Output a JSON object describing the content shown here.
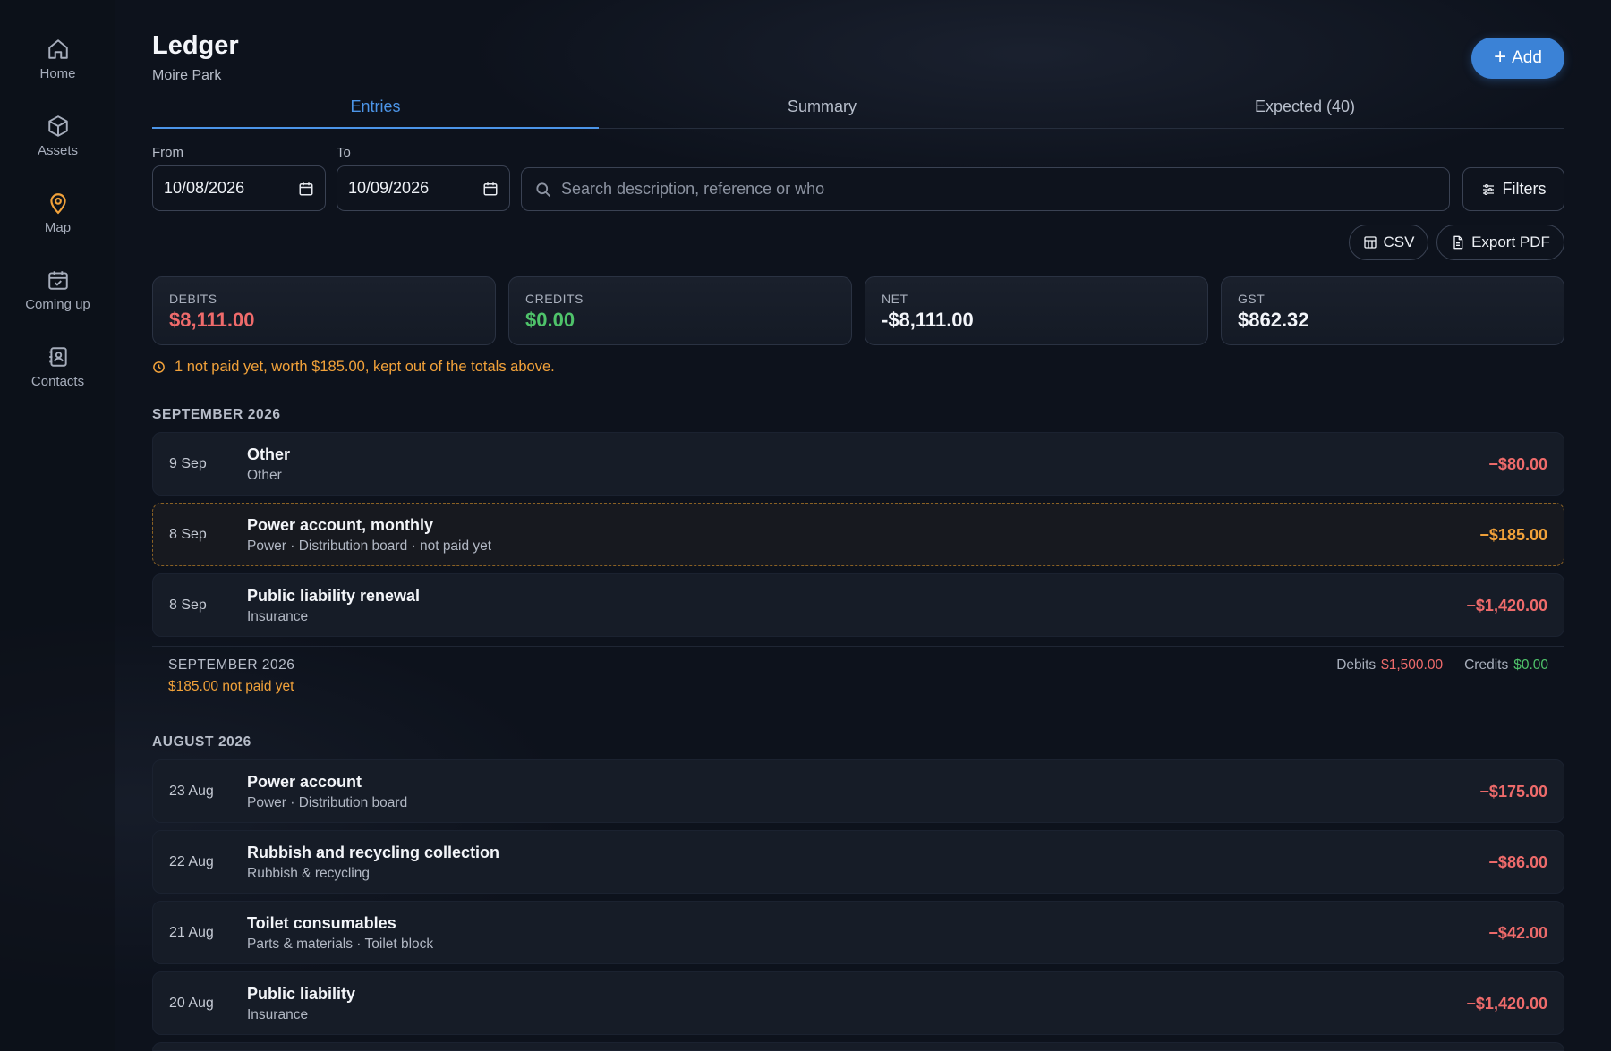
{
  "sidebar": {
    "items": [
      {
        "label": "Home",
        "icon": "home-icon",
        "active": false
      },
      {
        "label": "Assets",
        "icon": "cube-icon",
        "active": false
      },
      {
        "label": "Map",
        "icon": "map-pin-icon",
        "active": true
      },
      {
        "label": "Coming up",
        "icon": "calendar-check-icon",
        "active": false
      },
      {
        "label": "Contacts",
        "icon": "contact-book-icon",
        "active": false
      }
    ]
  },
  "header": {
    "title": "Ledger",
    "subtitle": "Moire Park",
    "add_label": "Add"
  },
  "tabs": [
    {
      "label": "Entries",
      "active": true
    },
    {
      "label": "Summary",
      "active": false
    },
    {
      "label": "Expected (40)",
      "active": false
    }
  ],
  "filters": {
    "from_label": "From",
    "from_value": "10/08/2026",
    "to_label": "To",
    "to_value": "10/09/2026",
    "search_placeholder": "Search description, reference or who",
    "filters_label": "Filters",
    "csv_label": "CSV",
    "pdf_label": "Export PDF"
  },
  "stats": {
    "debits": {
      "label": "DEBITS",
      "value": "$8,111.00"
    },
    "credits": {
      "label": "CREDITS",
      "value": "$0.00"
    },
    "net": {
      "label": "NET",
      "value": "-$8,111.00"
    },
    "gst": {
      "label": "GST",
      "value": "$862.32"
    }
  },
  "warning": "1 not paid yet, worth $185.00, kept out of the totals above.",
  "september": {
    "heading": "SEPTEMBER 2026",
    "entries": [
      {
        "date": "9 Sep",
        "name": "Other",
        "category": "Other",
        "amount": "−$80.00",
        "pending": false
      },
      {
        "date": "8 Sep",
        "name": "Power account, monthly",
        "category": "Power · Distribution board · not paid yet",
        "amount": "−$185.00",
        "pending": true
      },
      {
        "date": "8 Sep",
        "name": "Public liability renewal",
        "category": "Insurance",
        "amount": "−$1,420.00",
        "pending": false
      }
    ],
    "summary": {
      "label": "SEPTEMBER 2026",
      "pending": "$185.00 not paid yet",
      "debits_label": "Debits",
      "debits_value": "$1,500.00",
      "credits_label": "Credits",
      "credits_value": "$0.00"
    }
  },
  "august": {
    "heading": "AUGUST 2026",
    "entries": [
      {
        "date": "23 Aug",
        "name": "Power account",
        "category": "Power · Distribution board",
        "amount": "−$175.00",
        "pending": false
      },
      {
        "date": "22 Aug",
        "name": "Rubbish and recycling collection",
        "category": "Rubbish & recycling",
        "amount": "−$86.00",
        "pending": false
      },
      {
        "date": "21 Aug",
        "name": "Toilet consumables",
        "category": "Parts & materials · Toilet block",
        "amount": "−$42.00",
        "pending": false
      },
      {
        "date": "20 Aug",
        "name": "Public liability",
        "category": "Insurance",
        "amount": "−$1,420.00",
        "pending": false
      }
    ]
  },
  "colors": {
    "accent": "#3b82d6",
    "debit": "#ef6b6b",
    "credit": "#4fc36a",
    "pending": "#f2a23a"
  }
}
